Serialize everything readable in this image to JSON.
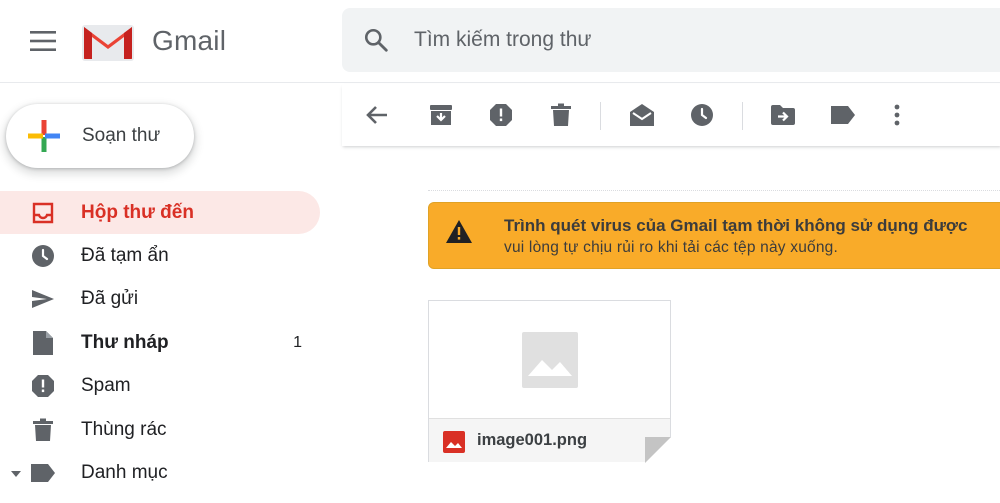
{
  "header": {
    "app_name": "Gmail",
    "search_placeholder": "Tìm kiếm trong thư"
  },
  "compose": {
    "label": "Soạn thư"
  },
  "sidebar": {
    "items": [
      {
        "label": "Hộp thư đến",
        "icon": "inbox-icon",
        "active": true
      },
      {
        "label": "Đã tạm ẩn",
        "icon": "clock-icon"
      },
      {
        "label": "Đã gửi",
        "icon": "send-icon"
      },
      {
        "label": "Thư nháp",
        "icon": "draft-icon",
        "count": "1",
        "bold": true
      },
      {
        "label": "Spam",
        "icon": "report-icon"
      },
      {
        "label": "Thùng rác",
        "icon": "trash-icon"
      },
      {
        "label": "Danh mục",
        "icon": "label-icon",
        "expandable": true
      }
    ]
  },
  "toolbar": {
    "buttons": [
      "back-icon",
      "archive-icon",
      "report-spam-icon",
      "delete-icon",
      "mark-unread-icon",
      "snooze-icon",
      "move-to-icon",
      "label-icon",
      "more-icon"
    ]
  },
  "banner": {
    "title": "Trình quét virus của Gmail tạm thời không sử dụng được",
    "subtitle": "vui lòng tự chịu rủi ro khi tải các tệp này xuống.",
    "color": "#f9ab29"
  },
  "attachment": {
    "filename": "image001.png",
    "type_icon": "image-file-icon"
  },
  "colors": {
    "accent": "#d93025",
    "active_bg": "#fce8e6",
    "icon_gray": "#5f6368"
  }
}
